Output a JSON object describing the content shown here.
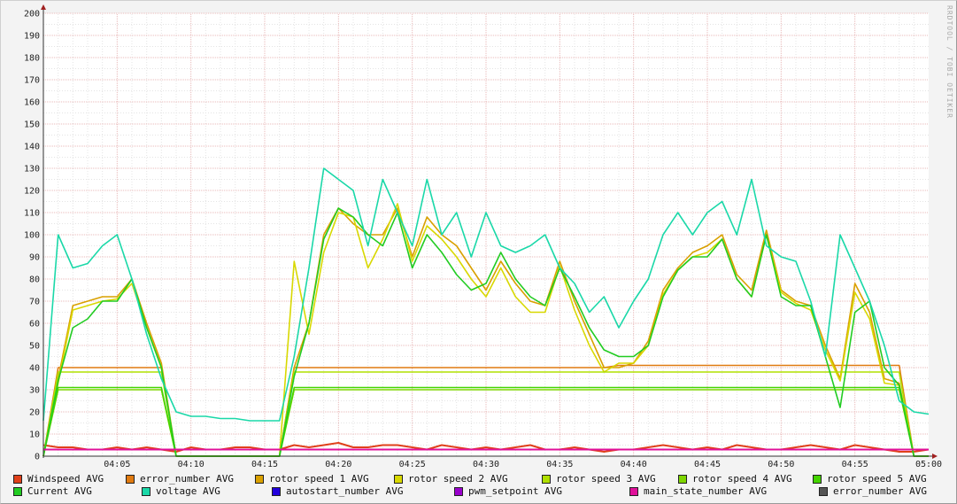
{
  "watermark": "RRDTOOL / TOBI OETIKER",
  "chart_data": {
    "type": "line",
    "title": "",
    "xlabel": "",
    "ylabel": "",
    "ylim": [
      0,
      200
    ],
    "y_ticks": [
      "0",
      "10",
      "20",
      "30",
      "40",
      "50",
      "60",
      "70",
      "80",
      "90",
      "100",
      "110",
      "120",
      "130",
      "140",
      "150",
      "160",
      "170",
      "180",
      "190",
      "200"
    ],
    "x_range_minutes": [
      0,
      60
    ],
    "x_ticks": [
      {
        "minute": 5,
        "label": "04:05"
      },
      {
        "minute": 10,
        "label": "04:10"
      },
      {
        "minute": 15,
        "label": "04:15"
      },
      {
        "minute": 20,
        "label": "04:20"
      },
      {
        "minute": 25,
        "label": "04:25"
      },
      {
        "minute": 30,
        "label": "04:30"
      },
      {
        "minute": 35,
        "label": "04:35"
      },
      {
        "minute": 40,
        "label": "04:40"
      },
      {
        "minute": 45,
        "label": "04:45"
      },
      {
        "minute": 50,
        "label": "04:50"
      },
      {
        "minute": 55,
        "label": "04:55"
      },
      {
        "minute": 60,
        "label": "05:00"
      }
    ],
    "grid": true,
    "legend_position": "bottom",
    "series": [
      {
        "name": "Windspeed AVG",
        "color": "#e0401a",
        "values": [
          5,
          4,
          4,
          3,
          3,
          4,
          3,
          4,
          3,
          2,
          4,
          3,
          3,
          4,
          4,
          3,
          3,
          5,
          4,
          5,
          6,
          4,
          4,
          5,
          5,
          4,
          3,
          5,
          4,
          3,
          4,
          3,
          4,
          5,
          3,
          3,
          4,
          3,
          2,
          3,
          3,
          4,
          5,
          4,
          3,
          4,
          3,
          5,
          4,
          3,
          3,
          4,
          5,
          4,
          3,
          5,
          4,
          3,
          2,
          2,
          3
        ]
      },
      {
        "name": "error_number AVG",
        "color": "#e07a10",
        "values": [
          0,
          40,
          40,
          40,
          40,
          40,
          40,
          40,
          40,
          0,
          0,
          0,
          0,
          0,
          0,
          0,
          0,
          40,
          40,
          40,
          40,
          40,
          40,
          40,
          40,
          40,
          40,
          40,
          40,
          40,
          40,
          40,
          40,
          40,
          40,
          40,
          40,
          40,
          40,
          41,
          41,
          41,
          41,
          41,
          41,
          41,
          41,
          41,
          41,
          41,
          41,
          41,
          41,
          41,
          41,
          41,
          41,
          41,
          41,
          0,
          0
        ]
      },
      {
        "name": "rotor speed 1 AVG",
        "color": "#d9a000",
        "values": [
          0,
          35,
          68,
          70,
          72,
          72,
          80,
          60,
          42,
          0,
          0,
          0,
          0,
          0,
          0,
          0,
          0,
          40,
          60,
          100,
          112,
          105,
          100,
          100,
          112,
          90,
          108,
          100,
          95,
          85,
          75,
          88,
          78,
          70,
          68,
          88,
          70,
          55,
          40,
          40,
          42,
          52,
          75,
          85,
          92,
          95,
          100,
          82,
          75,
          102,
          75,
          70,
          68,
          50,
          35,
          78,
          65,
          35,
          33,
          0,
          0
        ]
      },
      {
        "name": "rotor speed 2 AVG",
        "color": "#d8d800",
        "values": [
          0,
          33,
          66,
          68,
          70,
          71,
          78,
          58,
          40,
          0,
          0,
          0,
          0,
          0,
          0,
          0,
          0,
          88,
          55,
          92,
          110,
          108,
          85,
          98,
          114,
          88,
          104,
          98,
          90,
          80,
          72,
          85,
          72,
          65,
          65,
          86,
          66,
          50,
          38,
          42,
          42,
          50,
          73,
          84,
          90,
          92,
          98,
          80,
          72,
          100,
          74,
          69,
          66,
          48,
          34,
          74,
          62,
          33,
          32,
          0,
          0
        ]
      },
      {
        "name": "rotor speed 3 AVG",
        "color": "#b0e000",
        "values": [
          0,
          38,
          38,
          38,
          38,
          38,
          38,
          38,
          38,
          0,
          0,
          0,
          0,
          0,
          0,
          0,
          0,
          38,
          38,
          38,
          38,
          38,
          38,
          38,
          38,
          38,
          38,
          38,
          38,
          38,
          38,
          38,
          38,
          38,
          38,
          38,
          38,
          38,
          38,
          38,
          38,
          38,
          38,
          38,
          38,
          38,
          38,
          38,
          38,
          38,
          38,
          38,
          38,
          38,
          38,
          38,
          38,
          38,
          38,
          0,
          0
        ]
      },
      {
        "name": "rotor speed 4 AVG",
        "color": "#7ed600",
        "values": [
          0,
          30,
          30,
          30,
          30,
          30,
          30,
          30,
          30,
          0,
          0,
          0,
          0,
          0,
          0,
          0,
          0,
          30,
          30,
          30,
          30,
          30,
          30,
          30,
          30,
          30,
          30,
          30,
          30,
          30,
          30,
          30,
          30,
          30,
          30,
          30,
          30,
          30,
          30,
          30,
          30,
          30,
          30,
          30,
          30,
          30,
          30,
          30,
          30,
          30,
          30,
          30,
          30,
          30,
          30,
          30,
          30,
          30,
          30,
          0,
          0
        ]
      },
      {
        "name": "rotor speed 5 AVG",
        "color": "#44d400",
        "values": [
          0,
          31,
          31,
          31,
          31,
          31,
          31,
          31,
          31,
          0,
          0,
          0,
          0,
          0,
          0,
          0,
          0,
          31,
          31,
          31,
          31,
          31,
          31,
          31,
          31,
          31,
          31,
          31,
          31,
          31,
          31,
          31,
          31,
          31,
          31,
          31,
          31,
          31,
          31,
          31,
          31,
          31,
          31,
          31,
          31,
          31,
          31,
          31,
          31,
          31,
          31,
          31,
          31,
          31,
          31,
          31,
          31,
          31,
          31,
          0,
          0
        ]
      },
      {
        "name": "Current AVG",
        "color": "#22cc22",
        "values": [
          0,
          34,
          58,
          62,
          70,
          70,
          80,
          58,
          40,
          0,
          0,
          0,
          0,
          0,
          0,
          0,
          0,
          36,
          60,
          98,
          112,
          108,
          100,
          95,
          110,
          85,
          100,
          92,
          82,
          75,
          78,
          92,
          80,
          72,
          68,
          85,
          72,
          58,
          48,
          45,
          45,
          50,
          72,
          84,
          90,
          90,
          98,
          80,
          72,
          100,
          72,
          68,
          68,
          45,
          22,
          65,
          70,
          40,
          32,
          0,
          0
        ]
      },
      {
        "name": "voltage AVG",
        "color": "#1ad8a8",
        "values": [
          16,
          100,
          85,
          87,
          95,
          100,
          80,
          55,
          35,
          20,
          18,
          18,
          17,
          17,
          16,
          16,
          16,
          45,
          85,
          130,
          125,
          120,
          95,
          125,
          110,
          95,
          125,
          100,
          110,
          90,
          110,
          95,
          92,
          95,
          100,
          85,
          78,
          65,
          72,
          58,
          70,
          80,
          100,
          110,
          100,
          110,
          115,
          100,
          125,
          95,
          90,
          88,
          70,
          45,
          100,
          85,
          70,
          50,
          25,
          20,
          19
        ]
      },
      {
        "name": "autostart_number AVG",
        "color": "#2200dd",
        "values": []
      },
      {
        "name": "pwm_setpoint AVG",
        "color": "#9900cc",
        "values": []
      },
      {
        "name": "main_state_number AVG",
        "color": "#e0109a",
        "values": [
          3,
          3,
          3,
          3,
          3,
          3,
          3,
          3,
          3,
          3,
          3,
          3,
          3,
          3,
          3,
          3,
          3,
          3,
          3,
          3,
          3,
          3,
          3,
          3,
          3,
          3,
          3,
          3,
          3,
          3,
          3,
          3,
          3,
          3,
          3,
          3,
          3,
          3,
          3,
          3,
          3,
          3,
          3,
          3,
          3,
          3,
          3,
          3,
          3,
          3,
          3,
          3,
          3,
          3,
          3,
          3,
          3,
          3,
          3,
          3,
          3
        ]
      },
      {
        "name": "error_number AVG",
        "color": "#555555",
        "values": []
      }
    ]
  }
}
